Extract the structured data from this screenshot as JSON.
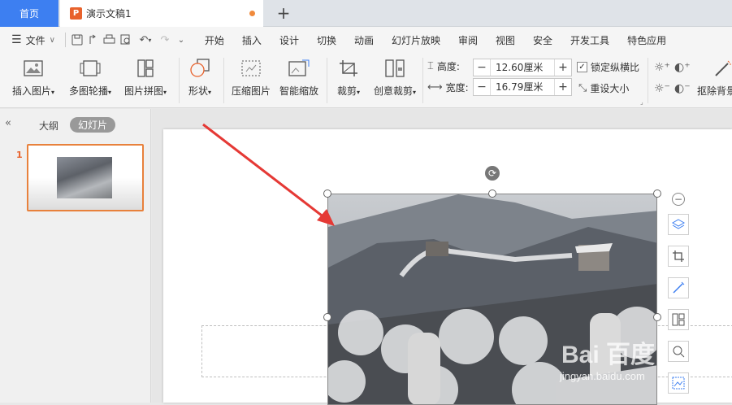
{
  "tabs": {
    "home": "首页",
    "doc": "演示文稿1",
    "doc_icon": "P",
    "add": "+"
  },
  "menu": {
    "file": "文件",
    "items": [
      "开始",
      "插入",
      "设计",
      "切换",
      "动画",
      "幻灯片放映",
      "审阅",
      "视图",
      "安全",
      "开发工具",
      "特色应用"
    ]
  },
  "ribbon": {
    "insert_picture": "插入图片",
    "multi_carousel": "多图轮播",
    "picture_collage": "图片拼图",
    "shape": "形状",
    "compress_picture": "压缩图片",
    "smart_zoom": "智能缩放",
    "crop": "裁剪",
    "creative_crop": "创意裁剪",
    "height_label": "高度:",
    "height_value": "12.60厘米",
    "width_label": "宽度:",
    "width_value": "16.79厘米",
    "lock_ratio": "锁定纵横比",
    "reset_size": "重设大小",
    "remove_bg": "抠除背景"
  },
  "panel": {
    "collapse": "«",
    "outline": "大纲",
    "slides": "幻灯片",
    "slide_number": "1"
  },
  "watermark": {
    "logo": "Bai 百度",
    "sub": "jingyan.baidu.com"
  },
  "colors": {
    "accent": "#3d7ff1",
    "wps_orange": "#e8622c",
    "annotation_arrow": "#e53935"
  }
}
